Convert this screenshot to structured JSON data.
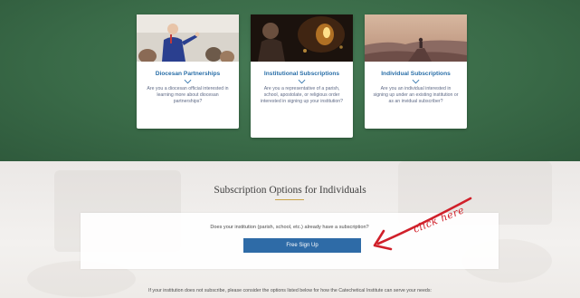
{
  "cards": [
    {
      "title": "Diocesan Partnerships",
      "description": "Are you a diocesan official interested in learning more about diocesan partnerships?",
      "icon": "chevron-down-icon"
    },
    {
      "title": "Institutional Subscriptions",
      "description": "Are you a representative of a parish, school, apostolate, or religious order interested in signing up your institution?",
      "icon": "chevron-down-icon"
    },
    {
      "title": "Individual Subscriptions",
      "description": "Are you an individual interested in signing up under an existing institution or as an invidual subscriber?",
      "icon": "chevron-down-icon"
    }
  ],
  "section": {
    "title": "Subscription Options for Individuals",
    "question": "Does your institution (parish, school, etc.) already have a subscription?",
    "button_label": "Free Sign Up",
    "footnote": "If your institution does not subscribe, please consider the options listed below for how the Catechetical Institute can serve your needs:"
  },
  "annotation": {
    "text": "click here",
    "color": "#d0202a"
  },
  "colors": {
    "hero_green": "#3a6b48",
    "link_blue": "#2a6fa8",
    "button_blue": "#2e6ba7",
    "gold_rule": "#c9a44a"
  }
}
